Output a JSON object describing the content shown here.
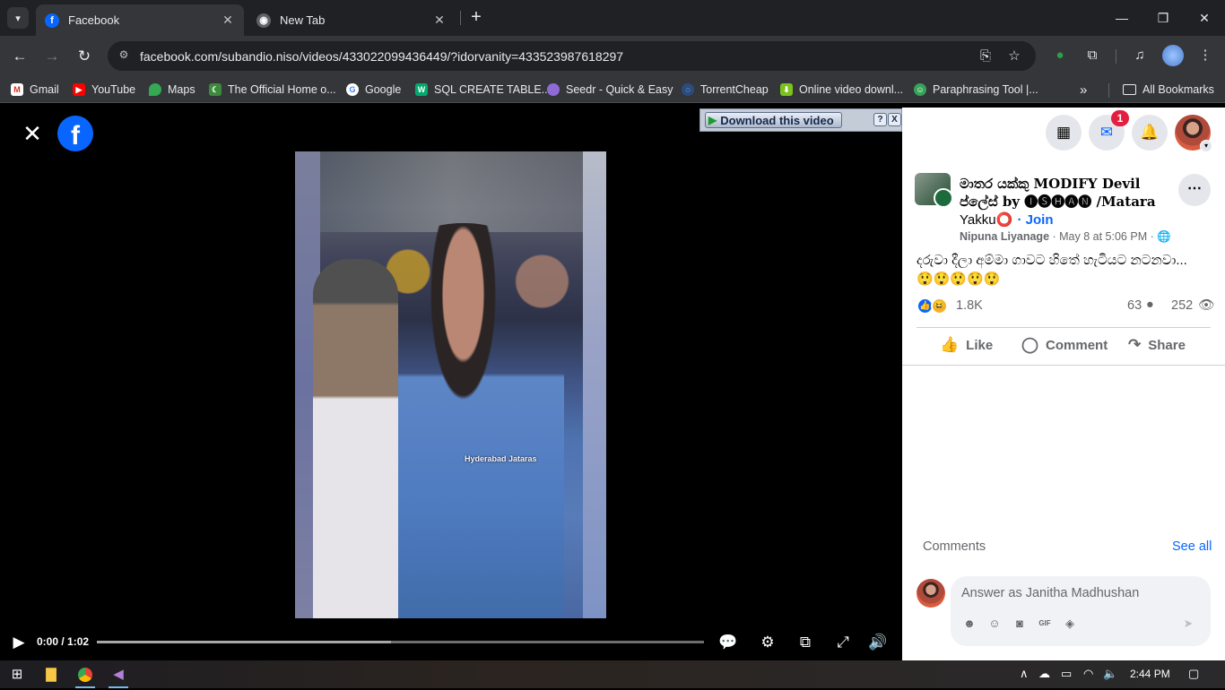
{
  "browser": {
    "tabs": [
      {
        "label": "Facebook",
        "active": true
      },
      {
        "label": "New Tab",
        "active": false
      }
    ],
    "url": "facebook.com/subandio.niso/videos/433022099436449/?idorvanity=433523987618297",
    "bookmarks": [
      {
        "label": "Gmail",
        "icon": "gmail-icon"
      },
      {
        "label": "YouTube",
        "icon": "youtube-icon"
      },
      {
        "label": "Maps",
        "icon": "maps-icon"
      },
      {
        "label": "The Official Home o...",
        "icon": "site-icon"
      },
      {
        "label": "Google",
        "icon": "google-icon"
      },
      {
        "label": "SQL CREATE TABLE...",
        "icon": "w3schools-icon"
      },
      {
        "label": "Seedr - Quick & Easy",
        "icon": "seedr-icon"
      },
      {
        "label": "TorrentCheap",
        "icon": "torrent-icon"
      },
      {
        "label": "Online video downl...",
        "icon": "download-icon"
      },
      {
        "label": "Paraphrasing Tool |...",
        "icon": "robot-icon"
      }
    ],
    "all_bookmarks_label": "All Bookmarks",
    "overflow_label": "»"
  },
  "video": {
    "download_label": "Download this video",
    "download_help": "?",
    "download_close": "X",
    "watermark": "Hyderabad Jataras",
    "time": "0:00 / 1:02",
    "played_fraction": 0.0,
    "buffered_fraction": 0.485
  },
  "panel": {
    "notification_count": "1",
    "group_name": "මාතර යක්කු MODIFY Devil ප්ලේස් by 🅘🅢🅗🅐🅝 /Matara",
    "group_name_tail": "Yakku⭕",
    "join_label": "· Join",
    "author": "Nipuna Liyanage",
    "meta_rest": " · May 8 at 5:06 PM · ",
    "caption": "දරුවා දීලා අම්මා ගාවට හිතේ හැටියට නටනවා...😲😲😲😲😲",
    "reaction_count": "1.8K",
    "comment_count": "63",
    "view_count": "252",
    "actions": {
      "like": "Like",
      "comment": "Comment",
      "share": "Share"
    },
    "comments_label": "Comments",
    "see_all_label": "See all",
    "comment_placeholder": "Answer as Janitha Madhushan"
  },
  "taskbar": {
    "clock": "2:44 PM"
  },
  "colors": {
    "facebook_blue": "#0866ff",
    "chrome_dark": "#35363a",
    "notification_red": "#e41e3f"
  }
}
